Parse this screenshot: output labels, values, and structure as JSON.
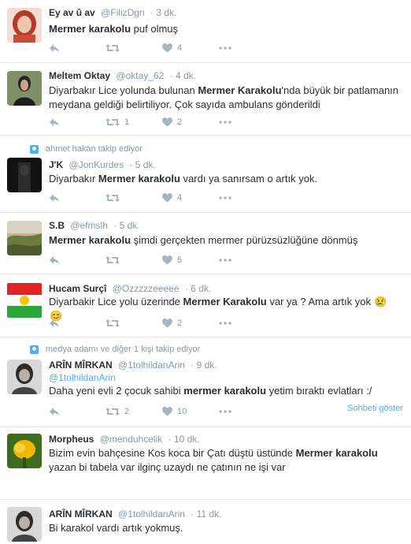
{
  "tweets": [
    {
      "name": "Ey av û av",
      "handle": "@FilizDgn",
      "time": "· 3 dk.",
      "text_parts": [
        {
          "t": "Mermer karakolu",
          "b": true
        },
        {
          "t": " puf olmuş",
          "b": false
        }
      ],
      "likes": "4"
    },
    {
      "name": "Meltem Oktay",
      "handle": "@oktay_62",
      "time": "· 4 dk.",
      "text_parts": [
        {
          "t": "Diyarbakır Lice yolunda bulunan ",
          "b": false
        },
        {
          "t": "Mermer Karakolu",
          "b": true
        },
        {
          "t": "'nda büyük bir patlamanın meydana geldiği belirtiliyor. Çok sayıda ambulans gönderildi",
          "b": false
        }
      ],
      "retweets": "1",
      "likes": "2"
    },
    {
      "context": "ahmet hakan takip ediyor",
      "name": "J'K",
      "handle": "@JonKurdes",
      "time": "· 5 dk.",
      "text_parts": [
        {
          "t": "Diyarbakır ",
          "b": false
        },
        {
          "t": "Mermer karakolu",
          "b": true
        },
        {
          "t": " vardı ya sanırsam o artık yok.",
          "b": false
        }
      ],
      "likes": "4"
    },
    {
      "name": "S.B",
      "handle": "@efmslh",
      "time": "· 5 dk.",
      "text_parts": [
        {
          "t": "Mermer karakolu",
          "b": true
        },
        {
          "t": " şimdi gerçekten mermer pürüzsüzlüğüne dönmüş",
          "b": false
        }
      ],
      "likes": "5"
    },
    {
      "name": "Hucam Surçî",
      "handle": "@Ozzzzzeeeee",
      "time": "· 6 dk.",
      "text_parts": [
        {
          "t": "Diyarbakir Lice yolu üzerinde ",
          "b": false
        },
        {
          "t": "Mermer Karakolu",
          "b": true
        },
        {
          "t": " var ya ? Ama artık yok",
          "b": false
        }
      ],
      "emoji": [
        "😢",
        "😊"
      ],
      "likes": "2"
    },
    {
      "context": "medya adamı ve diğer 1 kişi takip ediyor",
      "name": "ARÎN MÎRKAN",
      "handle": "@1tolhildanArin",
      "time": "· 9 dk.",
      "reply_to": "@1tolhildanArin",
      "text_parts": [
        {
          "t": "Daha yeni evli 2 çocuk sahibi ",
          "b": false
        },
        {
          "t": "mermer karakolu",
          "b": true
        },
        {
          "t": " yetim bıraktı evlatları :/",
          "b": false
        }
      ],
      "retweets": "2",
      "likes": "10",
      "thread_link": "Sohbeti göster"
    },
    {
      "name": "Morpheus",
      "handle": "@menduhcelik",
      "time": "· 10 dk.",
      "text_parts": [
        {
          "t": "Bizim evin bahçesine Kos koca bir Çatı düştü üstünde ",
          "b": false
        },
        {
          "t": "Mermer karakolu",
          "b": true
        },
        {
          "t": " yazan bi tabela var ilginç uzaydı ne çatının ne işi var",
          "b": false
        }
      ]
    },
    {
      "name": "ARÎN MÎRKAN",
      "handle": "@1tolhildanArin",
      "time": "· 11 dk.",
      "text_parts": [
        {
          "t": "Bi karakol vardı artık yokmuş.",
          "b": false
        }
      ]
    }
  ],
  "colors": {
    "link": "#55acee",
    "muted": "#8899a6",
    "icon": "#a8b5bf",
    "border": "#e1e8ed"
  },
  "icons": [
    "reply-icon",
    "retweet-icon",
    "like-icon",
    "more-icon",
    "follow-context-icon"
  ]
}
